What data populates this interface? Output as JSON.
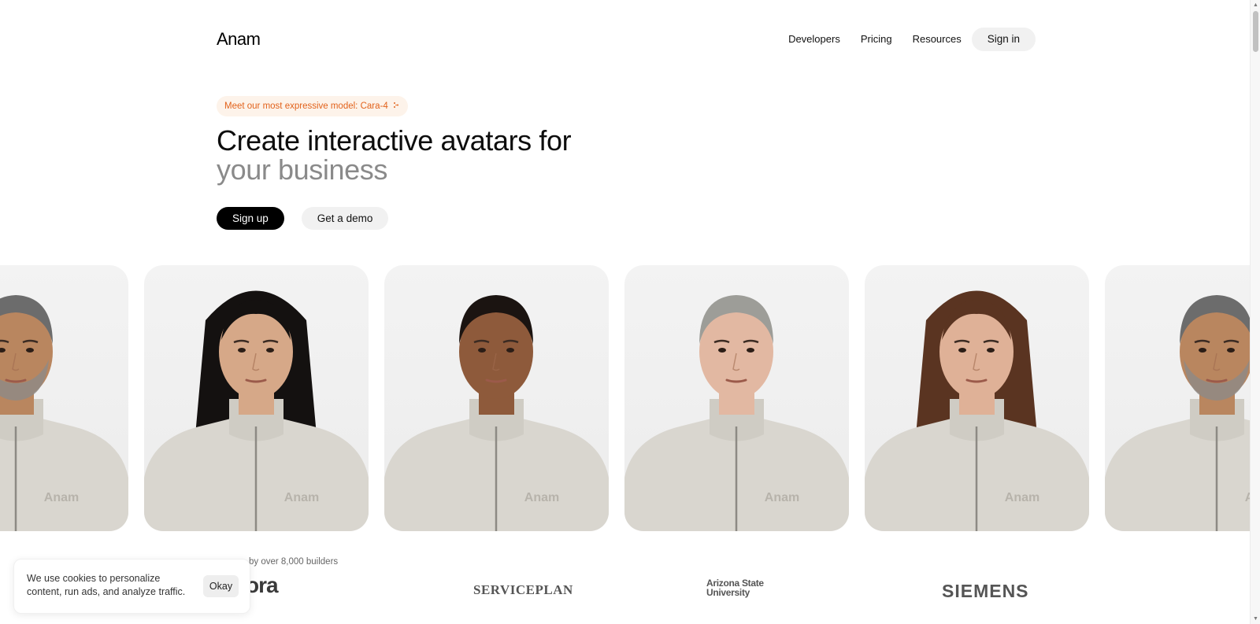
{
  "brand": {
    "name": "Anam"
  },
  "nav": {
    "links": [
      "Developers",
      "Pricing",
      "Resources"
    ],
    "signin_label": "Sign in"
  },
  "hero": {
    "badge_text": "Meet our most expressive model: Cara-4",
    "badge_icon": "sparkle-icon",
    "title_line1": "Create interactive avatars for",
    "title_line2": "your business",
    "signup_label": "Sign up",
    "demo_label": "Get a demo"
  },
  "avatars": [
    {
      "name": "avatar-man-gray-beard",
      "shirt_text": "Anam",
      "skin": "#b9865f",
      "hair": "#6c6c6c"
    },
    {
      "name": "avatar-woman-black-hair",
      "shirt_text": "Anam",
      "skin": "#d6a888",
      "hair": "#141110"
    },
    {
      "name": "avatar-woman-short-hair",
      "shirt_text": "Anam",
      "skin": "#8e5a3b",
      "hair": "#1b1411"
    },
    {
      "name": "avatar-man-gray-hair",
      "shirt_text": "Anam",
      "skin": "#e2b8a2",
      "hair": "#9d9d98"
    },
    {
      "name": "avatar-woman-curly-hair",
      "shirt_text": "Anam",
      "skin": "#dfb197",
      "hair": "#5a3421"
    },
    {
      "name": "avatar-man-gray-beard-repeat",
      "shirt_text": "Anam",
      "skin": "#b9865f",
      "hair": "#6c6c6c"
    }
  ],
  "trusted": {
    "text": "by over 8,000 builders",
    "logos": [
      "ora",
      "SERVICEPLAN",
      "Arizona State",
      "University",
      "SIEMENS"
    ]
  },
  "cookie": {
    "text": "We use cookies to personalize content, run ads, and analyze traffic.",
    "button_label": "Okay"
  },
  "colors": {
    "accent_orange": "#e2621b",
    "badge_bg": "#fdf3ea",
    "primary_button": "#000000",
    "secondary_button": "#f1f1f1",
    "title_gray": "#8a8a8a",
    "sweater": "#d9d6cf"
  }
}
